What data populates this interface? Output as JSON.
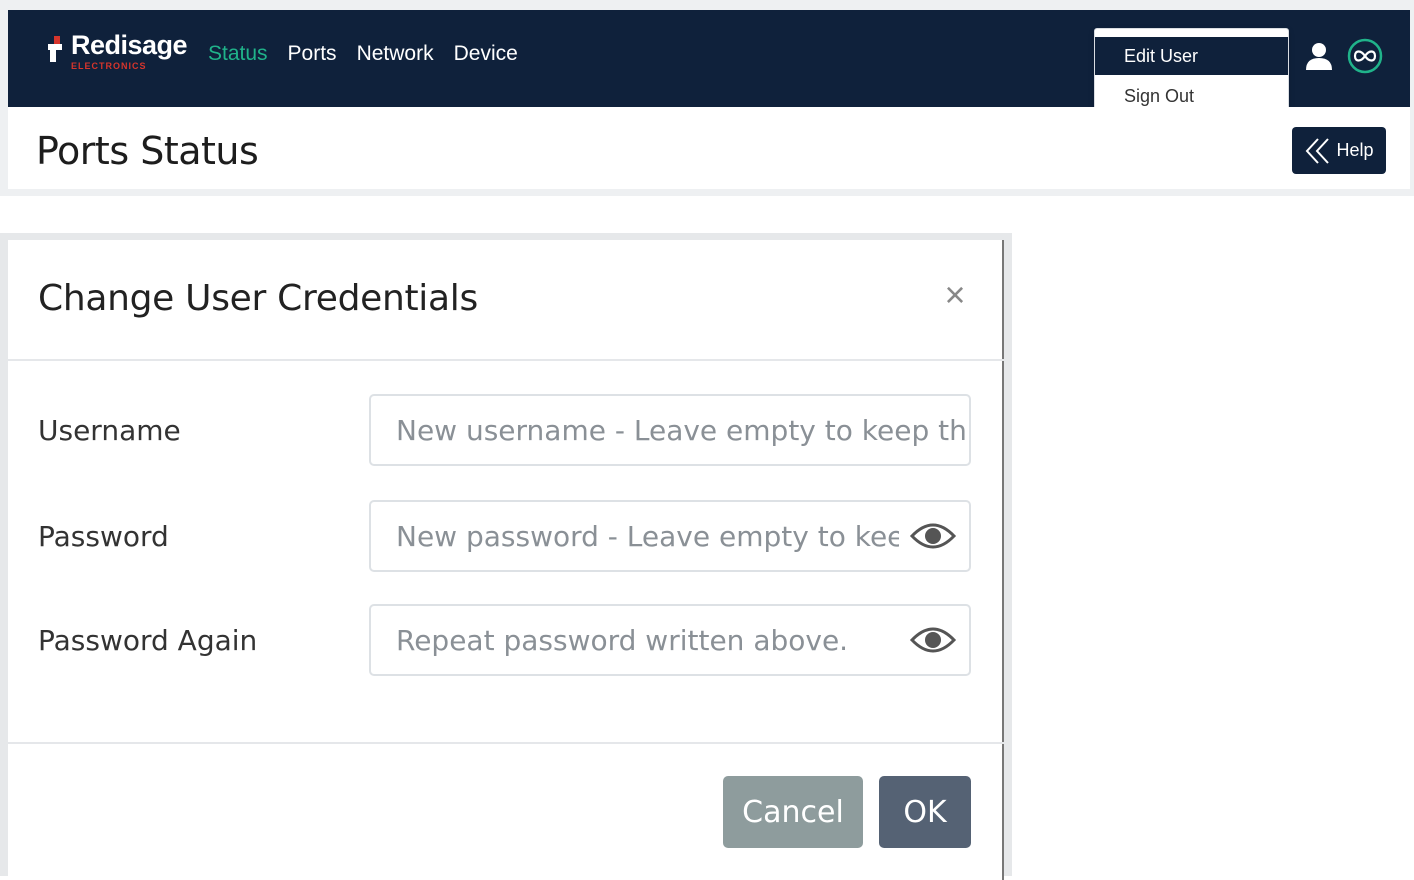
{
  "brand": {
    "name": "Redisage",
    "sub": "ELECTRONICS",
    "accent": "#d6352c"
  },
  "nav": {
    "items": [
      {
        "label": "Status",
        "active": true
      },
      {
        "label": "Ports"
      },
      {
        "label": "Network"
      },
      {
        "label": "Device"
      }
    ],
    "active_color": "#20b38a",
    "bg": "#0f213b"
  },
  "user_menu": {
    "items": [
      "Edit User",
      "Sign Out"
    ]
  },
  "top_icons": [
    "refresh-icon",
    "user-icon",
    "infinity-icon"
  ],
  "page": {
    "title": "Ports Status",
    "help_label": "Help"
  },
  "modal": {
    "title": "Change User Credentials",
    "close_symbol": "×",
    "fields": [
      {
        "label": "Username",
        "placeholder": "New username - Leave empty to keep the current one.",
        "value": ""
      },
      {
        "label": "Password",
        "placeholder": "New password - Leave empty to keep the current one.",
        "value": ""
      },
      {
        "label": "Password Again",
        "placeholder": "Repeat password written above.",
        "value": ""
      }
    ],
    "cancel_label": "Cancel",
    "ok_label": "OK"
  }
}
